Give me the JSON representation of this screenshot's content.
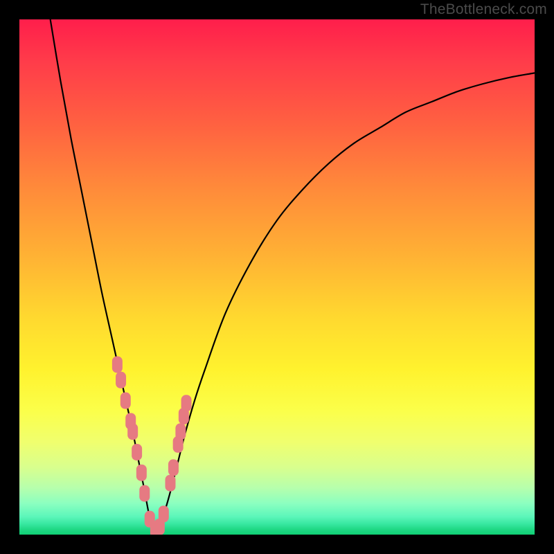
{
  "watermark": "TheBottleneck.com",
  "colors": {
    "frame": "#000000",
    "curve_stroke": "#000000",
    "marker_fill": "#e67a82",
    "gradient_top": "#ff1e4b",
    "gradient_bottom": "#10cf74"
  },
  "chart_data": {
    "type": "line",
    "title": "",
    "xlabel": "",
    "ylabel": "",
    "xlim": [
      0,
      100
    ],
    "ylim": [
      0,
      100
    ],
    "grid": false,
    "legend": false,
    "note": "V-shaped bottleneck curve; y is mismatch (high=red/bad, low=green/good). Minimum ≈ x=26, y≈0. Values estimated from pixels.",
    "series": [
      {
        "name": "bottleneck-curve",
        "x": [
          6,
          8,
          10,
          12,
          14,
          16,
          18,
          20,
          22,
          24,
          26,
          28,
          30,
          32,
          34,
          36,
          40,
          45,
          50,
          55,
          60,
          65,
          70,
          75,
          80,
          85,
          90,
          95,
          100
        ],
        "y": [
          100,
          88,
          77,
          67,
          57,
          47,
          38,
          29,
          20,
          10,
          1,
          4,
          11,
          19,
          26,
          32,
          43,
          53,
          61,
          67,
          72,
          76,
          79,
          82,
          84,
          86,
          87.5,
          88.7,
          89.6
        ]
      }
    ],
    "markers": {
      "name": "highlighted-points",
      "note": "pink rounded-rect clusters near the V; approximate sampled points",
      "x": [
        19.0,
        19.7,
        20.6,
        21.6,
        22.0,
        22.8,
        23.7,
        24.3,
        25.3,
        26.4,
        27.2,
        28.0,
        29.3,
        29.9,
        30.8,
        31.3,
        31.9,
        32.4
      ],
      "y": [
        33.0,
        30.0,
        26.0,
        22.0,
        20.0,
        16.0,
        12.0,
        8.0,
        3.0,
        1.0,
        1.5,
        4.0,
        10.0,
        13.0,
        17.5,
        20.0,
        23.0,
        25.5
      ]
    }
  }
}
